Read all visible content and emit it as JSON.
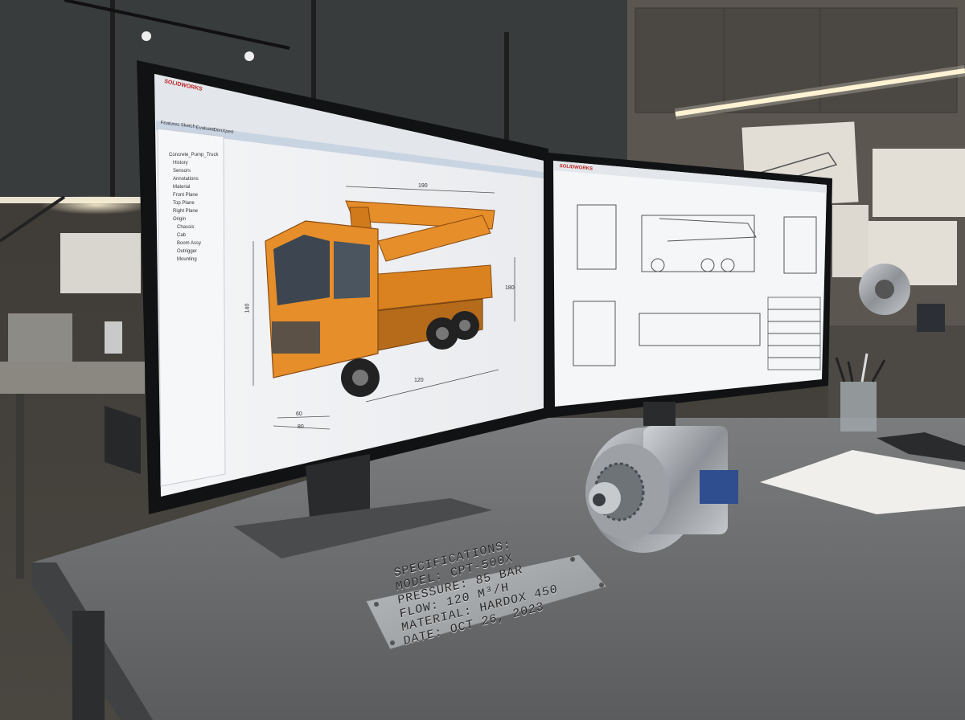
{
  "cad_window": {
    "app_title": "SOLIDWORKS",
    "tabs": [
      "Features",
      "Sketch",
      "Evaluate",
      "DimXpert"
    ],
    "tree_items": [
      "Concrete_Pump_Truck",
      "History",
      "Sensors",
      "Annotations",
      "Material",
      "Front Plane",
      "Top Plane",
      "Right Plane",
      "Origin",
      "Chassis",
      "Cab",
      "Boom Assy",
      "Outrigger",
      "Mounting"
    ],
    "dimension_labels": [
      "190",
      "140",
      "180",
      "120",
      "60",
      "80"
    ]
  },
  "drawing_window": {
    "app_title": "SOLIDWORKS"
  },
  "spec_plate": {
    "heading": "SPECIFICATIONS:",
    "model": "MODEL:   CPT-500X",
    "pressure": "PRESSURE: 85 BAR",
    "flow": "FLOW:     120 M³/H",
    "material": "MATERIAL: HARDOX 450",
    "date": "DATE:     OCT 26, 2023"
  }
}
